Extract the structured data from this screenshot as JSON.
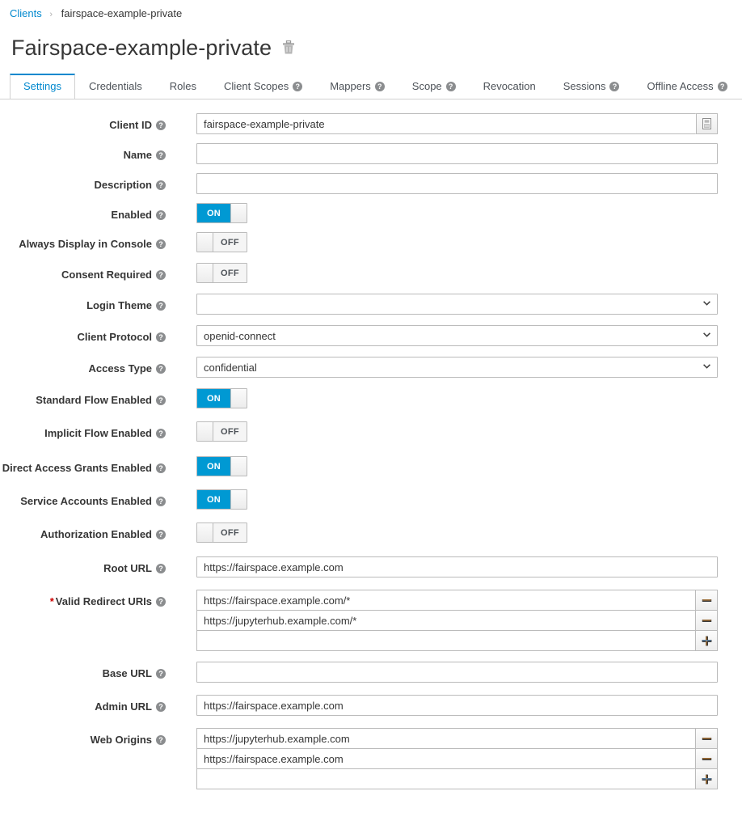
{
  "breadcrumb": {
    "parent": "Clients",
    "separator": "›",
    "current": "fairspace-example-private"
  },
  "page": {
    "title": "Fairspace-example-private",
    "delete_icon": "trash-icon"
  },
  "tabs": [
    {
      "label": "Settings",
      "active": true,
      "help": false
    },
    {
      "label": "Credentials",
      "active": false,
      "help": false
    },
    {
      "label": "Roles",
      "active": false,
      "help": false
    },
    {
      "label": "Client Scopes",
      "active": false,
      "help": true
    },
    {
      "label": "Mappers",
      "active": false,
      "help": true
    },
    {
      "label": "Scope",
      "active": false,
      "help": true
    },
    {
      "label": "Revocation",
      "active": false,
      "help": false
    },
    {
      "label": "Sessions",
      "active": false,
      "help": true
    },
    {
      "label": "Offline Access",
      "active": false,
      "help": true
    }
  ],
  "help_glyph": "?",
  "fields": {
    "client_id": {
      "label": "Client ID",
      "value": "fairspace-example-private",
      "required": false
    },
    "name": {
      "label": "Name",
      "value": "",
      "required": false
    },
    "description": {
      "label": "Description",
      "value": "",
      "required": false
    },
    "enabled": {
      "label": "Enabled",
      "state": "ON"
    },
    "always_display": {
      "label": "Always Display in Console",
      "state": "OFF"
    },
    "consent_required": {
      "label": "Consent Required",
      "state": "OFF"
    },
    "login_theme": {
      "label": "Login Theme",
      "value": ""
    },
    "client_protocol": {
      "label": "Client Protocol",
      "value": "openid-connect"
    },
    "access_type": {
      "label": "Access Type",
      "value": "confidential"
    },
    "standard_flow": {
      "label": "Standard Flow Enabled",
      "state": "ON"
    },
    "implicit_flow": {
      "label": "Implicit Flow Enabled",
      "state": "OFF"
    },
    "direct_access": {
      "label": "Direct Access Grants Enabled",
      "state": "ON"
    },
    "service_accounts": {
      "label": "Service Accounts Enabled",
      "state": "ON"
    },
    "authorization": {
      "label": "Authorization Enabled",
      "state": "OFF"
    },
    "root_url": {
      "label": "Root URL",
      "value": "https://fairspace.example.com"
    },
    "valid_redirect": {
      "label": "Valid Redirect URIs",
      "required": true,
      "required_mark": "*",
      "values": [
        "https://fairspace.example.com/*",
        "https://jupyterhub.example.com/*",
        ""
      ]
    },
    "base_url": {
      "label": "Base URL",
      "value": ""
    },
    "admin_url": {
      "label": "Admin URL",
      "value": "https://fairspace.example.com"
    },
    "web_origins": {
      "label": "Web Origins",
      "values": [
        "https://jupyterhub.example.com",
        "https://fairspace.example.com",
        ""
      ]
    }
  },
  "icons": {
    "copy": "copy-icon",
    "minus": "−",
    "plus": "+"
  },
  "colors": {
    "link": "#0088ce",
    "toggle_on": "#0099d3",
    "required": "#cc0000",
    "border": "#bbbbbb",
    "text": "#363636"
  }
}
